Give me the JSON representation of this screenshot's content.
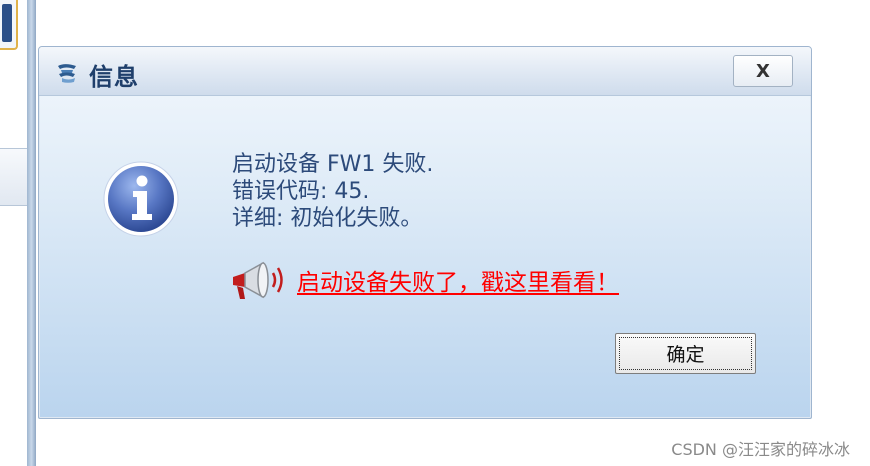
{
  "dialog": {
    "title": "信息",
    "close_label": "X",
    "message_lines": [
      "启动设备 FW1 失败.",
      "错误代码: 45.",
      "详细: 初始化失败。"
    ],
    "link_text": "启动设备失败了，戳这里看看！",
    "ok_label": "确定",
    "title_icon": "app-logo-icon",
    "info_icon": "info-icon",
    "link_icon": "megaphone-icon"
  },
  "watermark": "CSDN @汪汪家的碎冰冰",
  "colors": {
    "title_text": "#1f3f6b",
    "message_text": "#2c4a7a",
    "link_text": "#ff0000",
    "info_circle": "#3f5fa8"
  }
}
